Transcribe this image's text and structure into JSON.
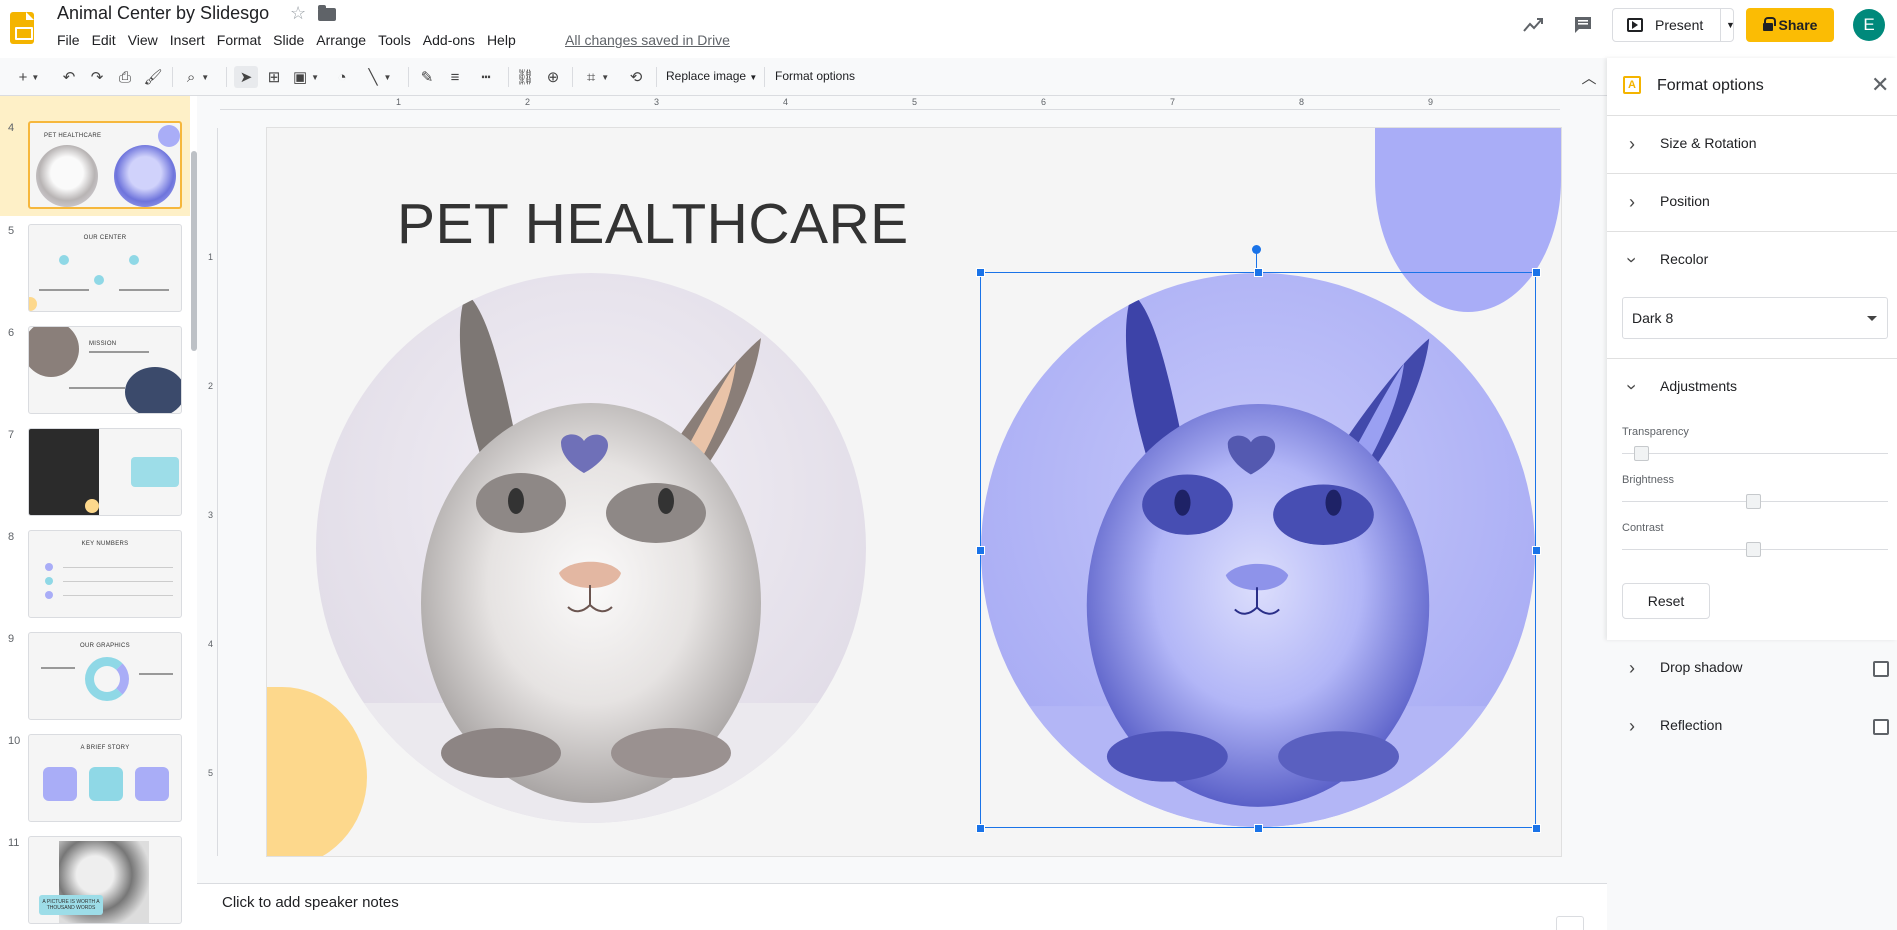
{
  "app": {
    "title": "Animal Center by Slidesgo",
    "menu": [
      "File",
      "Edit",
      "View",
      "Insert",
      "Format",
      "Slide",
      "Arrange",
      "Tools",
      "Add-ons",
      "Help"
    ],
    "save_status": "All changes saved in Drive",
    "present_label": "Present",
    "share_label": "Share",
    "avatar_initial": "E"
  },
  "toolbar": {
    "replace_image_label": "Replace image",
    "format_options_label": "Format options"
  },
  "filmstrip": {
    "slides": [
      {
        "num": "4",
        "title": "PET HEALTHCARE"
      },
      {
        "num": "5",
        "title": "OUR CENTER"
      },
      {
        "num": "6",
        "title": "MISSION"
      },
      {
        "num": "7",
        "title": ""
      },
      {
        "num": "8",
        "title": "KEY NUMBERS"
      },
      {
        "num": "9",
        "title": "OUR GRAPHICS"
      },
      {
        "num": "10",
        "title": "A BRIEF STORY"
      },
      {
        "num": "11",
        "title": "A PICTURE IS WORTH A THOUSAND WORDS"
      }
    ]
  },
  "ruler": {
    "top": [
      "1",
      "2",
      "3",
      "4",
      "5",
      "6",
      "7",
      "8",
      "9"
    ],
    "left": [
      "1",
      "2",
      "3",
      "4",
      "5"
    ]
  },
  "slide": {
    "title": "PET HEALTHCARE"
  },
  "notes": {
    "placeholder": "Click to add speaker notes"
  },
  "panel": {
    "title": "Format options",
    "sections": {
      "size_rotation": "Size & Rotation",
      "position": "Position",
      "recolor": "Recolor",
      "adjustments": "Adjustments",
      "drop_shadow": "Drop shadow",
      "reflection": "Reflection"
    },
    "recolor_value": "Dark 8",
    "sliders": {
      "transparency_label": "Transparency",
      "brightness_label": "Brightness",
      "contrast_label": "Contrast",
      "transparency": 0.0,
      "brightness": 0.5,
      "contrast": 0.5
    },
    "reset_label": "Reset"
  },
  "colors": {
    "accent_yellow": "#fbbc04",
    "selection_blue": "#1a73e8",
    "recolor_tint": "#a9adf7",
    "blob_yellow": "#fdd88c"
  }
}
